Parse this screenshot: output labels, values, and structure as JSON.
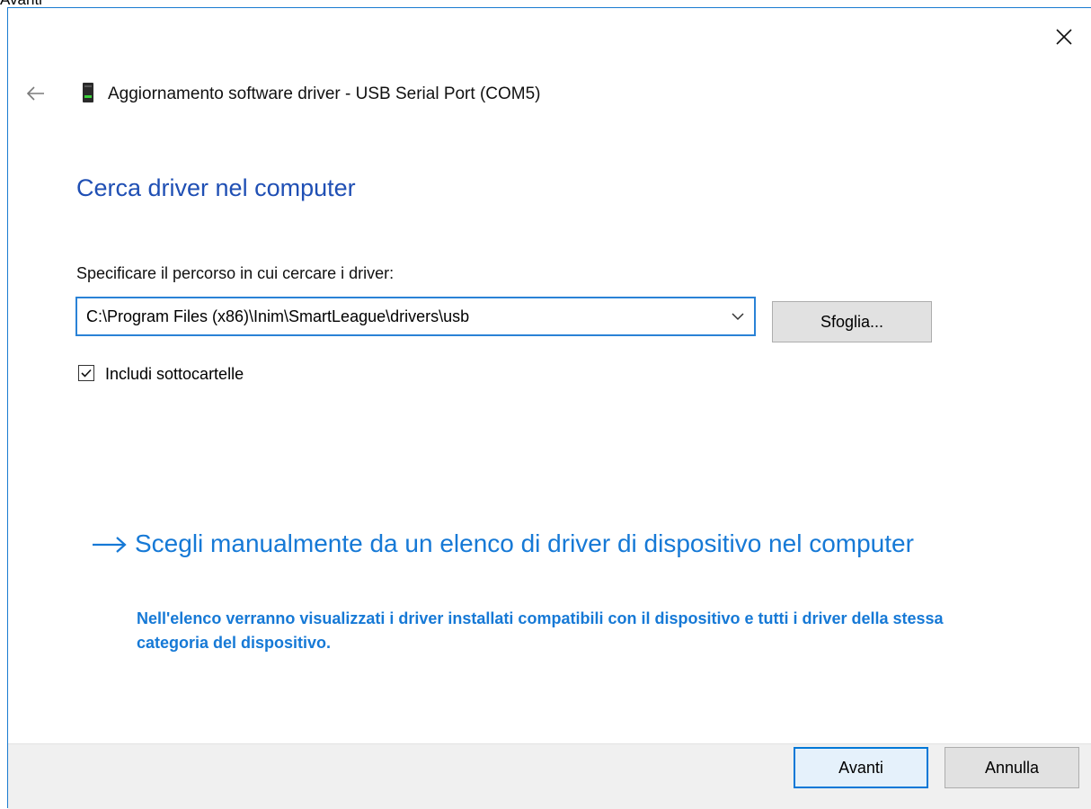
{
  "tooltip_fragment": "Avanti",
  "window": {
    "title": "Aggiornamento software driver - USB Serial Port (COM5)"
  },
  "page": {
    "heading": "Cerca driver nel computer",
    "path_label": "Specificare il percorso in cui cercare i driver:",
    "path_value": "C:\\Program Files (x86)\\Inim\\SmartLeague\\drivers\\usb",
    "browse_label": "Sfoglia...",
    "include_subfolders_label": "Includi sottocartelle",
    "include_subfolders_checked": true
  },
  "manual_option": {
    "title": "Scegli manualmente da un elenco di driver di dispositivo nel computer",
    "description": "Nell'elenco verranno visualizzati i driver installati compatibili con il dispositivo e tutti i driver della stessa categoria del dispositivo."
  },
  "footer": {
    "next_label": "Avanti",
    "cancel_label": "Annulla"
  },
  "colors": {
    "heading": "#1f4fb4",
    "link": "#1679d6",
    "focus_border": "#2a82d6",
    "footer_bg": "#f0f0f0"
  }
}
